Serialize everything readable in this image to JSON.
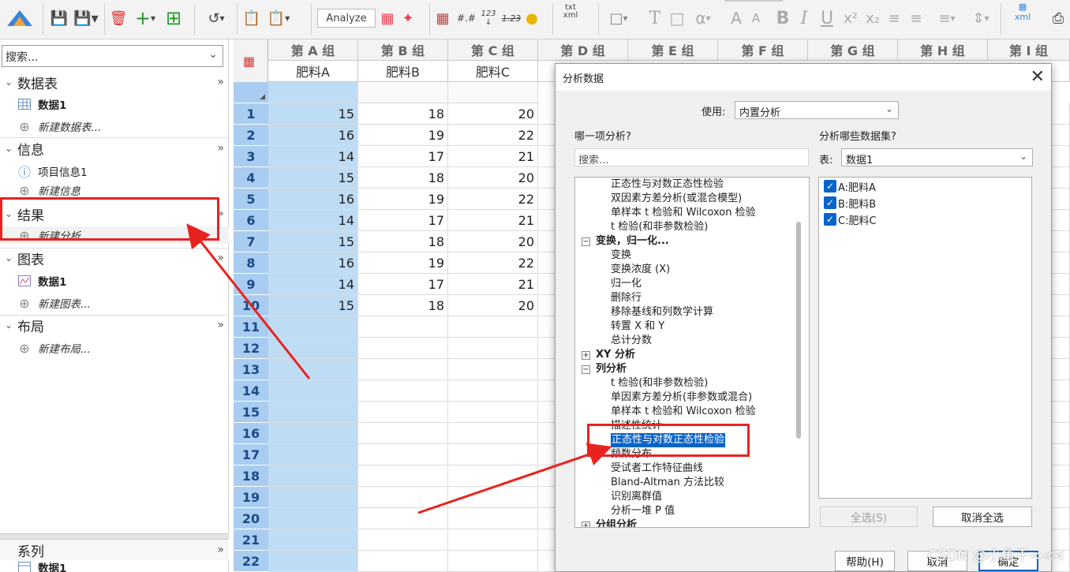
{
  "toolbar": {
    "analyze_label": "Analyze",
    "numformat_label": "123",
    "numformat_sub": "1.23",
    "txt_label": "txt",
    "xml_label": "xml"
  },
  "left_panel": {
    "search_placeholder": "搜索...",
    "sections": [
      {
        "title": "数据表",
        "items": [
          {
            "label": "数据1"
          },
          {
            "label": "新建数据表..."
          }
        ]
      },
      {
        "title": "信息",
        "items": [
          {
            "label": "项目信息1"
          },
          {
            "label": "新建信息"
          }
        ]
      },
      {
        "title": "结果",
        "items": [
          {
            "label": "新建分析"
          }
        ]
      },
      {
        "title": "图表",
        "items": [
          {
            "label": "数据1"
          },
          {
            "label": "新建图表..."
          }
        ]
      },
      {
        "title": "布局",
        "items": [
          {
            "label": "新建布局..."
          }
        ]
      }
    ],
    "bottom": {
      "title": "系列",
      "item": "数据1"
    },
    "more_glyph": "»"
  },
  "grid": {
    "column_groups": [
      "第 A 组",
      "第 B 组",
      "第 C 组",
      "第 D 组",
      "第 E 组",
      "第 F 组",
      "第 G 组",
      "第 H 组",
      "第 I 组"
    ],
    "subtitles": [
      "肥料A",
      "肥料B",
      "肥料C"
    ],
    "row_numbers": [
      "1",
      "2",
      "3",
      "4",
      "5",
      "6",
      "7",
      "8",
      "9",
      "10",
      "11",
      "12",
      "13",
      "14",
      "15",
      "16",
      "17",
      "18",
      "19",
      "20",
      "21",
      "22"
    ],
    "rows": [
      [
        "15",
        "18",
        "20"
      ],
      [
        "16",
        "19",
        "22"
      ],
      [
        "14",
        "17",
        "21"
      ],
      [
        "15",
        "18",
        "20"
      ],
      [
        "16",
        "19",
        "22"
      ],
      [
        "14",
        "17",
        "21"
      ],
      [
        "15",
        "18",
        "20"
      ],
      [
        "16",
        "19",
        "22"
      ],
      [
        "14",
        "17",
        "21"
      ],
      [
        "15",
        "18",
        "20"
      ]
    ]
  },
  "dialog": {
    "title": "分析数据",
    "use_label": "使用:",
    "use_value": "内置分析",
    "which_analysis_label": "哪一项分析?",
    "search_placeholder": "搜索...",
    "which_datasets_label": "分析哪些数据集?",
    "table_label": "表:",
    "table_value": "数据1",
    "tree": [
      {
        "label": "正态性与对数正态性检验",
        "kind": "leaf"
      },
      {
        "label": "双因素方差分析(或混合模型)",
        "kind": "leaf"
      },
      {
        "label": "单样本 t 检验和 Wilcoxon 检验",
        "kind": "leaf"
      },
      {
        "label": "t 检验(和非参数检验)",
        "kind": "leaf"
      },
      {
        "label": "变换，归一化...",
        "kind": "cat",
        "expander": "−"
      },
      {
        "label": "变换",
        "kind": "leaf"
      },
      {
        "label": "变换浓度 (X)",
        "kind": "leaf"
      },
      {
        "label": "归一化",
        "kind": "leaf"
      },
      {
        "label": "删除行",
        "kind": "leaf"
      },
      {
        "label": "移除基线和列数学计算",
        "kind": "leaf"
      },
      {
        "label": "转置 X 和 Y",
        "kind": "leaf"
      },
      {
        "label": "总计分数",
        "kind": "leaf"
      },
      {
        "label": "XY 分析",
        "kind": "cat",
        "expander": "+"
      },
      {
        "label": "列分析",
        "kind": "cat",
        "expander": "−"
      },
      {
        "label": "t 检验(和非参数检验)",
        "kind": "leaf"
      },
      {
        "label": "单因素方差分析(非参数或混合)",
        "kind": "leaf"
      },
      {
        "label": "单样本 t 检验和 Wilcoxon 检验",
        "kind": "leaf"
      },
      {
        "label": "描述性统计",
        "kind": "leaf"
      },
      {
        "label": "正态性与对数正态性检验",
        "kind": "leaf",
        "selected": true
      },
      {
        "label": "频数分布",
        "kind": "leaf"
      },
      {
        "label": "受试者工作特征曲线",
        "kind": "leaf"
      },
      {
        "label": "Bland-Altman 方法比较",
        "kind": "leaf"
      },
      {
        "label": "识别离群值",
        "kind": "leaf"
      },
      {
        "label": "分析一堆 P 值",
        "kind": "leaf"
      },
      {
        "label": "分组分析",
        "kind": "cat",
        "expander": "+"
      }
    ],
    "datasets": [
      "A:肥料A",
      "B:肥料B",
      "C:肥料C"
    ],
    "select_all": "全选(S)",
    "deselect_all": "取消全选",
    "help": "帮助(H)",
    "cancel": "取消",
    "ok": "确定"
  },
  "watermark": "CSDN @小鱼干<<<",
  "colors": {
    "selection": "#0a64c8",
    "row_header": "#a9cdf0",
    "column_a": "#bfdcf5",
    "annotation": "#e8231f"
  }
}
